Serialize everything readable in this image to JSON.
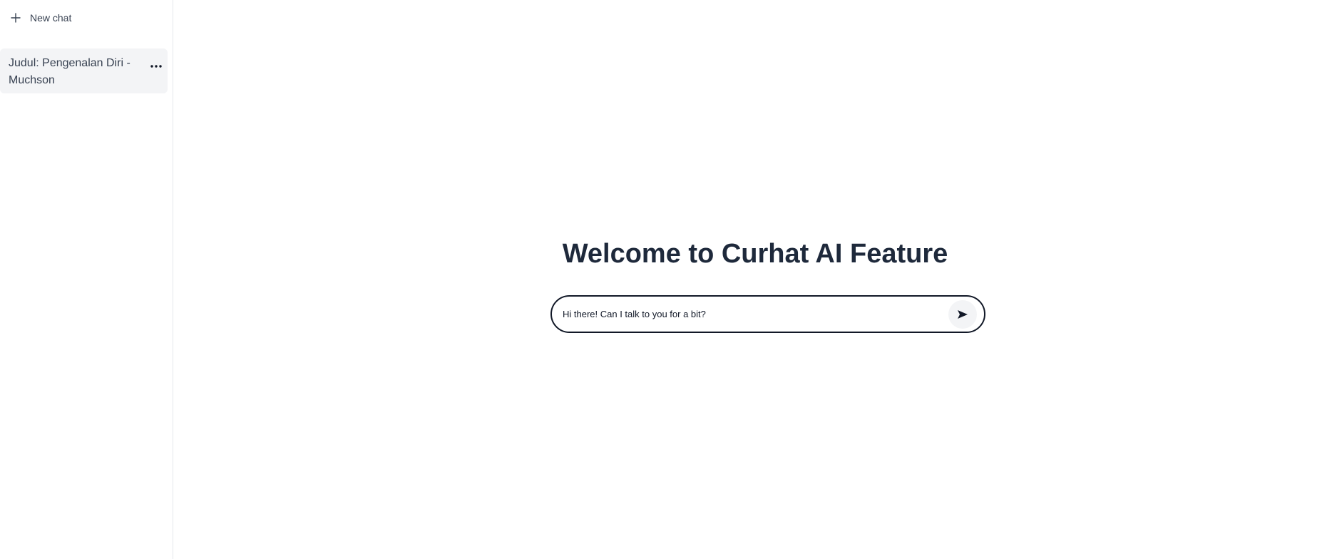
{
  "sidebar": {
    "new_chat": {
      "icon": "plus-icon",
      "label": "New chat"
    },
    "chats": [
      {
        "title": "Judul: Pengenalan Diri - Muchson",
        "menu_icon": "more-horizontal-icon",
        "active": true
      }
    ]
  },
  "main": {
    "title": "Welcome to Curhat AI Feature",
    "input": {
      "value": "Hi there! Can I talk to you for a bit?",
      "send_icon": "send-icon"
    }
  },
  "colors": {
    "title": "#1e293b",
    "active_chat_bg": "#f3f4f6",
    "input_border": "#111827",
    "send_button_bg": "#f3f4f6"
  }
}
